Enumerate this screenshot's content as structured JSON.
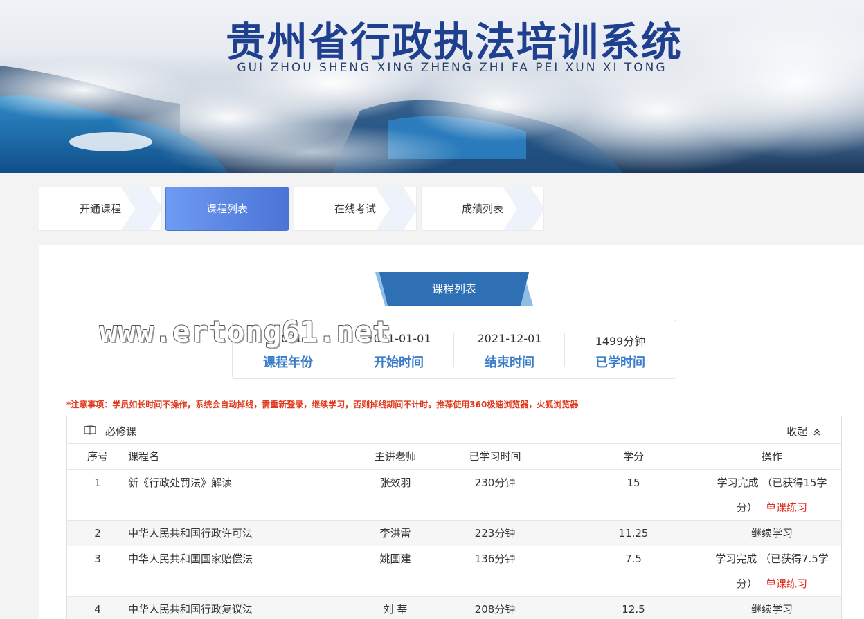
{
  "banner": {
    "title": "贵州省行政执法培训系统",
    "subtitle": "GUI ZHOU SHENG XING ZHENG ZHI FA PEI XUN XI TONG"
  },
  "tabs": [
    {
      "label": "开通课程",
      "active": false
    },
    {
      "label": "课程列表",
      "active": true
    },
    {
      "label": "在线考试",
      "active": false
    },
    {
      "label": "成绩列表",
      "active": false
    }
  ],
  "section": {
    "title": "课程列表"
  },
  "stats": [
    {
      "value": "2021",
      "label": "课程年份"
    },
    {
      "value": "2021-01-01",
      "label": "开始时间"
    },
    {
      "value": "2021-12-01",
      "label": "结束时间"
    },
    {
      "value": "1499分钟",
      "label": "已学时间"
    }
  ],
  "watermark": "www.ertong61.net",
  "notice": "*注意事项：学员如长时间不操作，系统会自动掉线，需重新登录，继续学习，否则掉线期间不计时。推荐使用360极速浏览器，火狐浏览器",
  "table": {
    "title": "必修课",
    "collapse_label": "收起",
    "headers": {
      "no": "序号",
      "name": "课程名",
      "teacher": "主讲老师",
      "time": "已学习时间",
      "credit": "学分",
      "op": "操作"
    },
    "rows": [
      {
        "no": "1",
        "name": "新《行政处罚法》解读",
        "teacher": "张效羽",
        "time": "230分钟",
        "credit": "15",
        "op_line1": "学习完成 （已获得15学",
        "op_line2": "分）",
        "op_link": "单课练习"
      },
      {
        "no": "2",
        "name": "中华人民共和国行政许可法",
        "teacher": "李洪雷",
        "time": "223分钟",
        "credit": "11.25",
        "op_line1": "继续学习"
      },
      {
        "no": "3",
        "name": "中华人民共和国国家赔偿法",
        "teacher": "姚国建",
        "time": "136分钟",
        "credit": "7.5",
        "op_line1": "学习完成 （已获得7.5学",
        "op_line2": "分）",
        "op_link": "单课练习"
      },
      {
        "no": "4",
        "name": "中华人民共和国行政复议法",
        "teacher": "刘 莘",
        "time": "208分钟",
        "credit": "12.5",
        "op_line1": "继续学习"
      }
    ]
  },
  "colors": {
    "accent": "#4a74d6",
    "label_blue": "#3a7dc9",
    "notice_red": "#e03a1e",
    "link_red": "#e0281a"
  }
}
